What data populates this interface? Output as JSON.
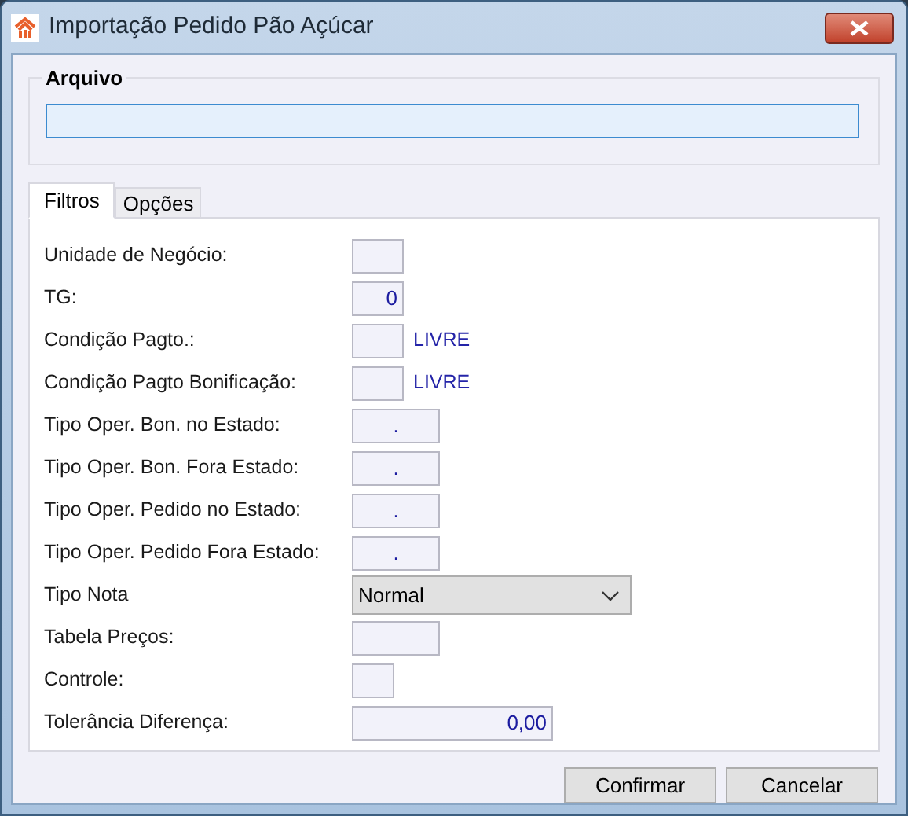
{
  "window": {
    "title": "Importação Pedido Pão Açúcar"
  },
  "arquivo": {
    "label": "Arquivo"
  },
  "tabs": [
    {
      "label": "Filtros",
      "selected": true
    },
    {
      "label": "Opções",
      "selected": false
    }
  ],
  "fields": [
    {
      "label": "Unidade de Negócio:",
      "kind": "short"
    },
    {
      "label": "TG:",
      "kind": "short",
      "value": "0"
    },
    {
      "label": "Condição Pagto.:",
      "kind": "short",
      "note": "LIVRE"
    },
    {
      "label": "Condição Pagto Bonificação:",
      "kind": "short",
      "note": "LIVRE"
    },
    {
      "label": "Tipo Oper. Bon. no Estado:",
      "kind": "medium",
      "value": "."
    },
    {
      "label": "Tipo Oper. Bon. Fora Estado:",
      "kind": "medium",
      "value": "."
    },
    {
      "label": "Tipo Oper. Pedido no Estado:",
      "kind": "medium",
      "value": "."
    },
    {
      "label": "Tipo Oper. Pedido Fora Estado:",
      "kind": "medium",
      "value": "."
    },
    {
      "label": "Tipo Nota",
      "kind": "select",
      "value": "Normal"
    },
    {
      "label": "Tabela Preços:",
      "kind": "medium"
    },
    {
      "label": "Controle:",
      "kind": "tiny"
    },
    {
      "label": "Tolerância Diferença:",
      "kind": "wide",
      "value": "0,00"
    }
  ],
  "buttons": [
    "Confirmar",
    "Cancelar"
  ]
}
